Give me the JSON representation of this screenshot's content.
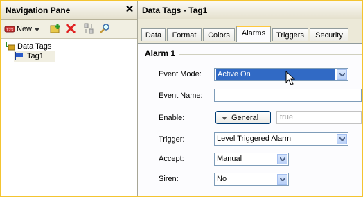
{
  "navigation": {
    "title": "Navigation Pane",
    "close_glyph": "✕",
    "toolbar": {
      "new_label": "New",
      "new_icon": "new-tag-icon",
      "add_icon": "add-item-icon",
      "delete_icon": "delete-icon",
      "sort_icon": "sort-icon",
      "search_icon": "search-icon"
    },
    "tree": [
      {
        "label": "Data Tags",
        "icon": "data-tags-icon"
      },
      {
        "label": "Tag1",
        "icon": "tag-flag-icon",
        "selected": true
      }
    ]
  },
  "panel": {
    "title": "Data Tags - Tag1",
    "tabs": [
      {
        "label": "Data"
      },
      {
        "label": "Format"
      },
      {
        "label": "Colors"
      },
      {
        "label": "Alarms",
        "active": true
      },
      {
        "label": "Triggers"
      },
      {
        "label": "Security"
      }
    ],
    "section_title": "Alarm 1",
    "fields": {
      "event_mode": {
        "label": "Event Mode:",
        "value": "Active On"
      },
      "event_name": {
        "label": "Event Name:",
        "value": ""
      },
      "enable": {
        "label": "Enable:",
        "button": "General",
        "value": "true"
      },
      "trigger": {
        "label": "Trigger:",
        "value": "Level Triggered Alarm"
      },
      "accept": {
        "label": "Accept:",
        "value": "Manual"
      },
      "siren": {
        "label": "Siren:",
        "value": "No"
      }
    }
  },
  "colors": {
    "highlight": "#316ac5",
    "accent_border": "#f4c430",
    "pane_bg": "#ece9d8"
  }
}
